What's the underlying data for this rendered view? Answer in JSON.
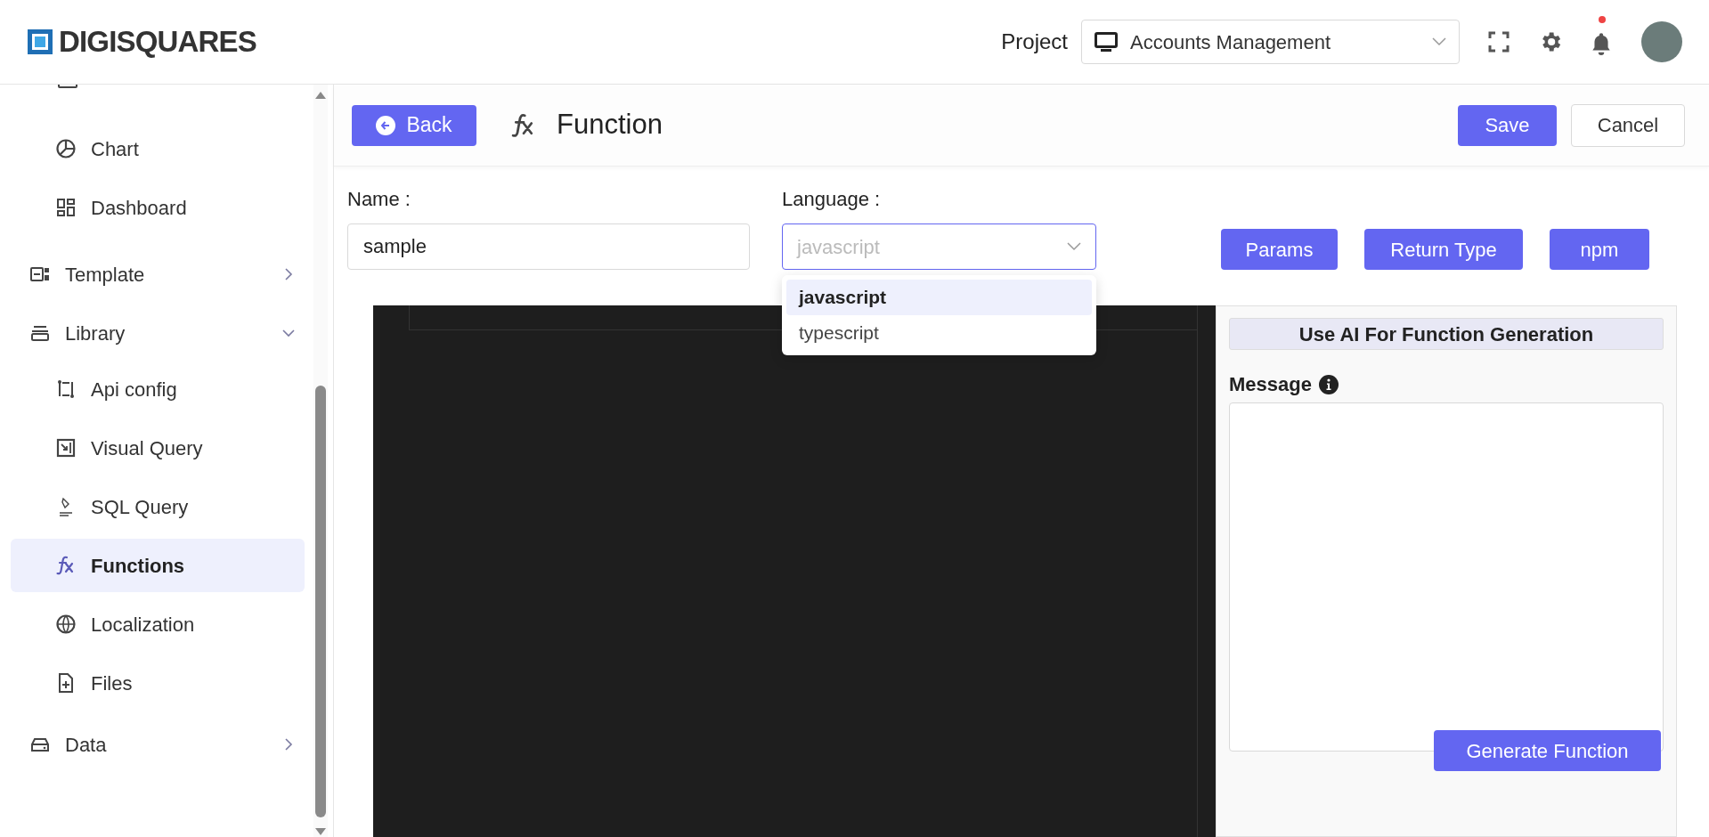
{
  "topbar": {
    "logo": "DIGISQUARES",
    "project_label": "Project",
    "project_select": {
      "value": "Accounts Management"
    },
    "notification": true
  },
  "sidebar": {
    "items": [
      {
        "kind": "group",
        "children": [
          {
            "label": "Chart",
            "selected": false
          },
          {
            "label": "Dashboard",
            "selected": false
          }
        ]
      },
      {
        "kind": "section",
        "label": "Template",
        "expanded": false
      },
      {
        "kind": "section",
        "label": "Library",
        "expanded": true,
        "children": [
          {
            "label": "Api config",
            "selected": false
          },
          {
            "label": "Visual Query",
            "selected": false
          },
          {
            "label": "SQL Query",
            "selected": false
          },
          {
            "label": "Functions",
            "selected": true
          },
          {
            "label": "Localization",
            "selected": false
          },
          {
            "label": "Files",
            "selected": false
          }
        ]
      },
      {
        "kind": "section",
        "label": "Data",
        "expanded": false
      }
    ]
  },
  "header": {
    "back_button": "Back",
    "title": "Function",
    "save_button": "Save",
    "cancel_button": "Cancel"
  },
  "form": {
    "name": {
      "label": "Name :",
      "value": "sample"
    },
    "language": {
      "label": "Language :",
      "value": "javascript",
      "open": true,
      "options": [
        {
          "label": "javascript",
          "selected": true
        },
        {
          "label": "typescript",
          "selected": false
        }
      ]
    },
    "buttons": [
      "Params",
      "Return Type",
      "npm"
    ]
  },
  "ai_panel": {
    "title": "Use AI For Function Generation",
    "message_label": "Message",
    "generate_button": "Generate Function"
  }
}
